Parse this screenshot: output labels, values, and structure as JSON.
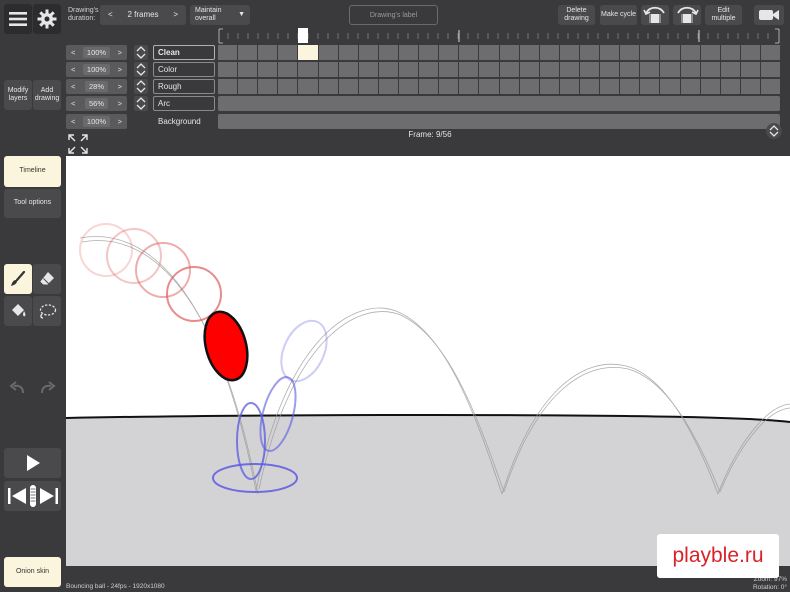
{
  "sidebar": {
    "modify_layers": "Modify layers",
    "add_drawing": "Add drawing",
    "timeline": "Timeline",
    "tool_options": "Tool options",
    "onion_skin": "Onion skin"
  },
  "toolbar": {
    "drawing_duration_label": "Drawing's duration:",
    "duration_prev": "<",
    "duration_value": "2 frames",
    "duration_next": ">",
    "maintain_overall": "Maintain overall",
    "drawing_label_placeholder": "Drawing's label",
    "delete_drawing": "Delete drawing",
    "make_cycle": "Make cycle",
    "edit_multiple": "Edit multiple"
  },
  "layers": [
    {
      "opacity": "100%",
      "name": "Clean",
      "active": true
    },
    {
      "opacity": "100%",
      "name": "Color",
      "active": false
    },
    {
      "opacity": "28%",
      "name": "Rough",
      "active": false
    },
    {
      "opacity": "56%",
      "name": "Arc",
      "active": false
    },
    {
      "opacity": "100%",
      "name": "Background",
      "active": false
    }
  ],
  "arrows": {
    "left": "<",
    "right": ">"
  },
  "frame_indicator": "Frame: 9/56",
  "status": {
    "project": "Bouncing ball - 24fps - 1920x1080",
    "zoom": "Zoom: 97%",
    "rotation": "Rotation: 0°"
  },
  "watermark": "playble.ru",
  "colors": {
    "ball": "#ff0000",
    "onion_prev": "#e05a5a",
    "onion_next": "#5a5ae0",
    "highlight": "#fbf5dd",
    "panel": "#3a3a3c"
  }
}
